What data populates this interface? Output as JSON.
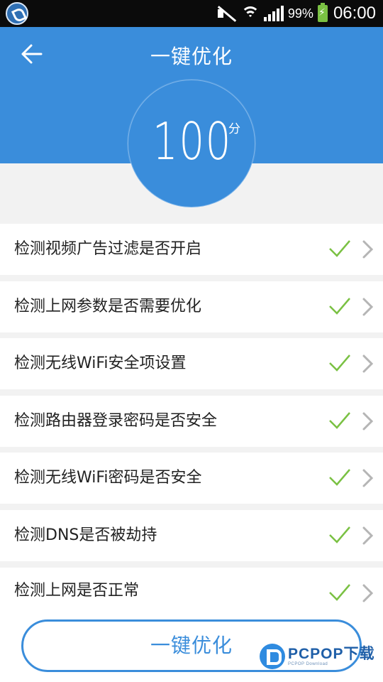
{
  "status_bar": {
    "battery_percent": "99%",
    "time": "06:00",
    "icons": [
      "app-notification-icon",
      "mute-icon",
      "wifi-icon",
      "signal-icon",
      "battery-charging-icon"
    ]
  },
  "header": {
    "title": "一键优化",
    "back_icon": "back-arrow-icon",
    "background_color": "#3a8ddb"
  },
  "score": {
    "value": "100",
    "unit": "分"
  },
  "checks": [
    {
      "label": "检测视频广告过滤是否开启",
      "status": "passed",
      "status_icon": "check-icon",
      "status_color": "#7ac143"
    },
    {
      "label": "检测上网参数是否需要优化",
      "status": "passed",
      "status_icon": "check-icon",
      "status_color": "#7ac143"
    },
    {
      "label": "检测无线WiFi安全项设置",
      "status": "passed",
      "status_icon": "check-icon",
      "status_color": "#7ac143"
    },
    {
      "label": "检测路由器登录密码是否安全",
      "status": "passed",
      "status_icon": "check-icon",
      "status_color": "#7ac143"
    },
    {
      "label": "检测无线WiFi密码是否安全",
      "status": "passed",
      "status_icon": "check-icon",
      "status_color": "#7ac143"
    },
    {
      "label": "检测DNS是否被劫持",
      "status": "passed",
      "status_icon": "check-icon",
      "status_color": "#7ac143"
    },
    {
      "label": "检测上网是否正常",
      "status": "passed",
      "status_icon": "check-icon",
      "status_color": "#7ac143"
    }
  ],
  "footer": {
    "optimize_button_label": "一键优化"
  },
  "watermark": {
    "main": "PCPOP下载",
    "sub": "PCPOP Download"
  }
}
